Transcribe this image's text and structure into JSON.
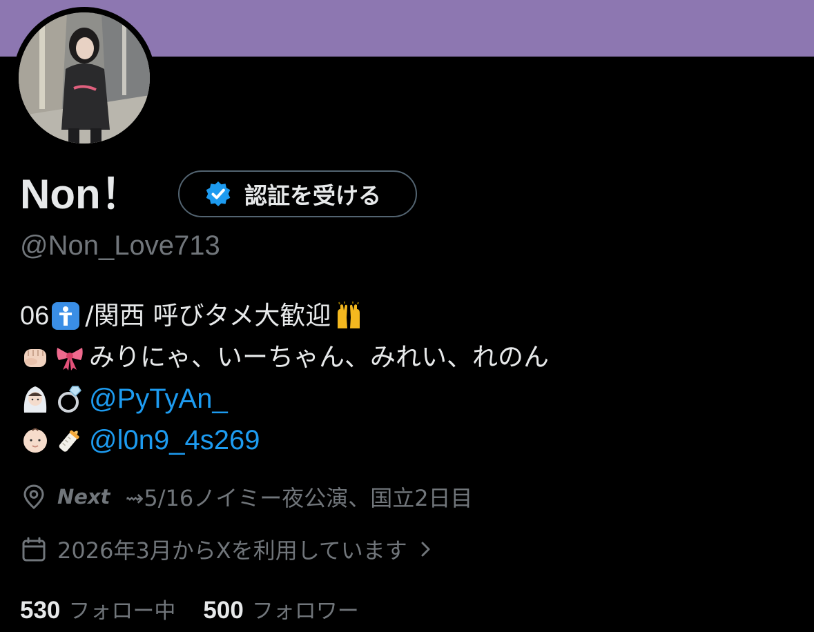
{
  "colors": {
    "banner": "#8d77b1",
    "background": "#000000",
    "primary_text": "#e7e9ea",
    "secondary_text": "#71767b",
    "link": "#1d9bf0",
    "verified_badge": "#1d9bf0"
  },
  "profile": {
    "avatar_icon": "profile-photo",
    "display_name": "Non！",
    "handle": "@Non_Love713",
    "verify_button": {
      "icon": "verified-badge-icon",
      "label": "認証を受ける"
    }
  },
  "bio": {
    "line1": {
      "prefix": "06",
      "emoji1": "information-emoji",
      "text": " /関西 呼びタメ大歓迎",
      "emoji2": "raising-hands-emoji"
    },
    "line2": {
      "emoji1": "fist-emoji",
      "emoji2": "ribbon-emoji",
      "text": "みりにゃ、いーちゃん、みれい、れのん"
    },
    "line3": {
      "emoji1": "bride-emoji",
      "emoji2": "ring-emoji",
      "mention": "@PyTyAn_"
    },
    "line4": {
      "emoji1": "baby-emoji",
      "emoji2": "baby-bottle-emoji",
      "mention": "@l0n9_4s269"
    }
  },
  "meta": {
    "location": {
      "icon": "location-pin-icon",
      "next_label": "Next",
      "text": "⇝5/16ノイミー夜公演、国立2日目"
    },
    "joined": {
      "icon": "calendar-icon",
      "text": "2026年3月からXを利用しています",
      "chevron_icon": "chevron-right-icon"
    }
  },
  "stats": {
    "following": {
      "count": "530",
      "label": "フォロー中"
    },
    "followers": {
      "count": "500",
      "label": "フォロワー"
    }
  }
}
